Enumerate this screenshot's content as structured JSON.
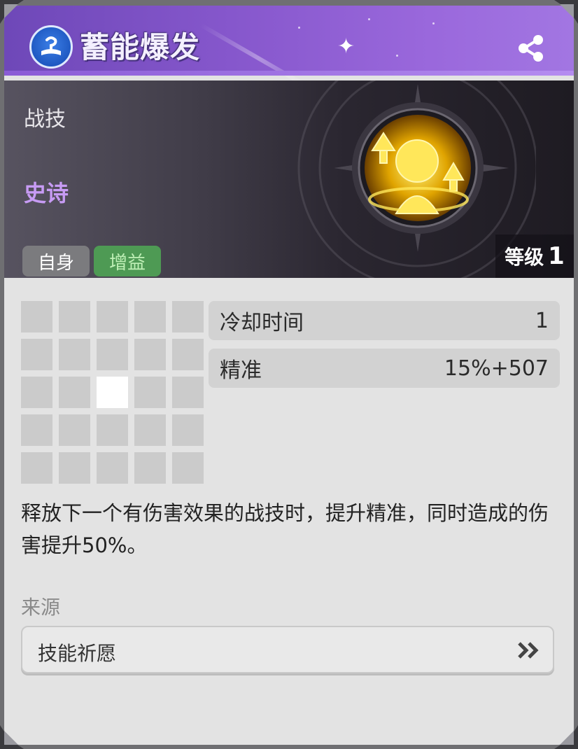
{
  "header": {
    "title": "蓄能爆发",
    "icon": "skill-book-icon",
    "share_icon": "share-icon",
    "colors": {
      "header": "#8657cc",
      "accent": "#a276e2"
    }
  },
  "banner": {
    "type_label": "战技",
    "rarity_label": "史诗",
    "rarity_color": "#c79bf4",
    "tags": [
      {
        "label": "自身",
        "color": "#7b7b7e"
      },
      {
        "label": "增益",
        "color": "#4e9a54"
      }
    ],
    "level_label": "等级",
    "level_value": "1",
    "emblem_icon": "meditating-figure-icon"
  },
  "range_grid": {
    "rows": 5,
    "cols": 5,
    "highlighted": [
      [
        2,
        2
      ]
    ]
  },
  "stats": [
    {
      "label": "冷却时间",
      "value": "1"
    },
    {
      "label": "精准",
      "value": "15%+507"
    }
  ],
  "description": "释放下一个有伤害效果的战技时，提升精准，同时造成的伤害提升50%。",
  "source": {
    "label": "来源",
    "button_text": "技能祈愿",
    "button_icon": "double-chevron-right-icon"
  }
}
